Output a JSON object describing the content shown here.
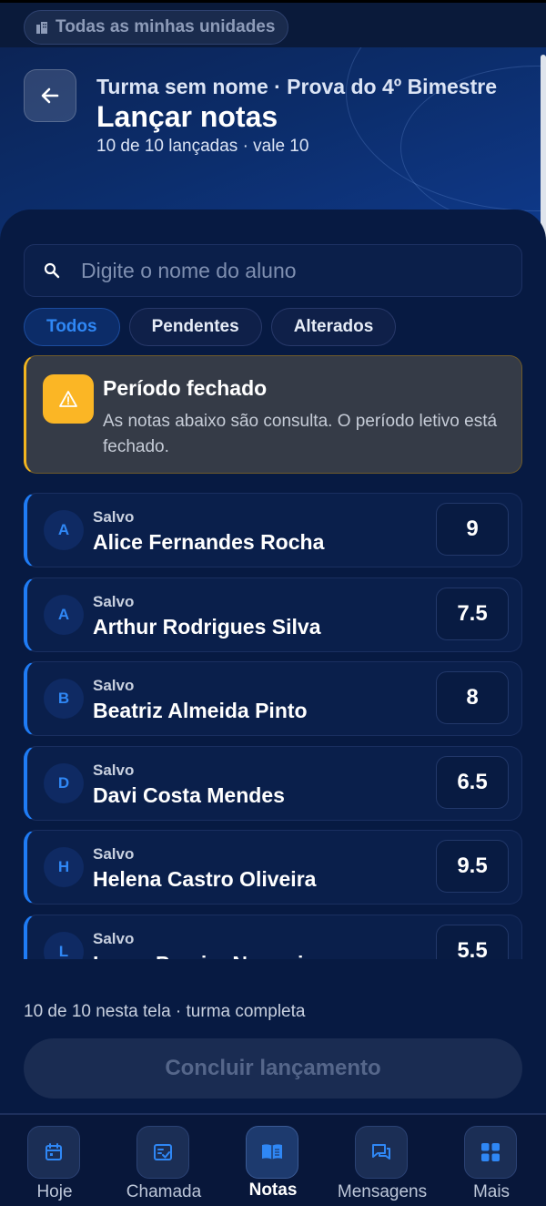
{
  "top_bar": {
    "unit_label": "Todas as minhas unidades",
    "icon": "building-icon"
  },
  "header": {
    "subtitle": "Turma sem nome · Prova do 4º Bimestre",
    "title": "Lançar notas",
    "meta": "10 de 10 lançadas · vale 10",
    "back_icon": "arrow-left-icon"
  },
  "search": {
    "placeholder": "Digite o nome do aluno",
    "value": ""
  },
  "filters": [
    {
      "label": "Todos",
      "active": true
    },
    {
      "label": "Pendentes",
      "active": false
    },
    {
      "label": "Alterados",
      "active": false
    }
  ],
  "alert": {
    "title": "Período fechado",
    "text": "As notas abaixo são consulta. O período letivo está fechado.",
    "icon": "warning-icon",
    "accent": "#f2b51f"
  },
  "students": [
    {
      "initial": "A",
      "status": "Salvo",
      "name": "Alice Fernandes Rocha",
      "grade": "9"
    },
    {
      "initial": "A",
      "status": "Salvo",
      "name": "Arthur Rodrigues Silva",
      "grade": "7.5"
    },
    {
      "initial": "B",
      "status": "Salvo",
      "name": "Beatriz Almeida Pinto",
      "grade": "8"
    },
    {
      "initial": "D",
      "status": "Salvo",
      "name": "Davi Costa Mendes",
      "grade": "6.5"
    },
    {
      "initial": "H",
      "status": "Salvo",
      "name": "Helena Castro Oliveira",
      "grade": "9.5"
    },
    {
      "initial": "L",
      "status": "Salvo",
      "name": "Laura Pereira Nogueira",
      "grade": "5.5"
    }
  ],
  "footer": {
    "note": "10 de 10 nesta tela · turma completa",
    "conclude_label": "Concluir lançamento"
  },
  "tabs": [
    {
      "label": "Hoje",
      "icon": "calendar-icon",
      "active": false
    },
    {
      "label": "Chamada",
      "icon": "checklist-icon",
      "active": false
    },
    {
      "label": "Notas",
      "icon": "book-icon",
      "active": true
    },
    {
      "label": "Mensagens",
      "icon": "chat-icon",
      "active": false
    },
    {
      "label": "Mais",
      "icon": "grid-icon",
      "active": false
    }
  ],
  "colors": {
    "accent_blue": "#2f87f5",
    "background": "#061433",
    "warning": "#fbb625"
  }
}
